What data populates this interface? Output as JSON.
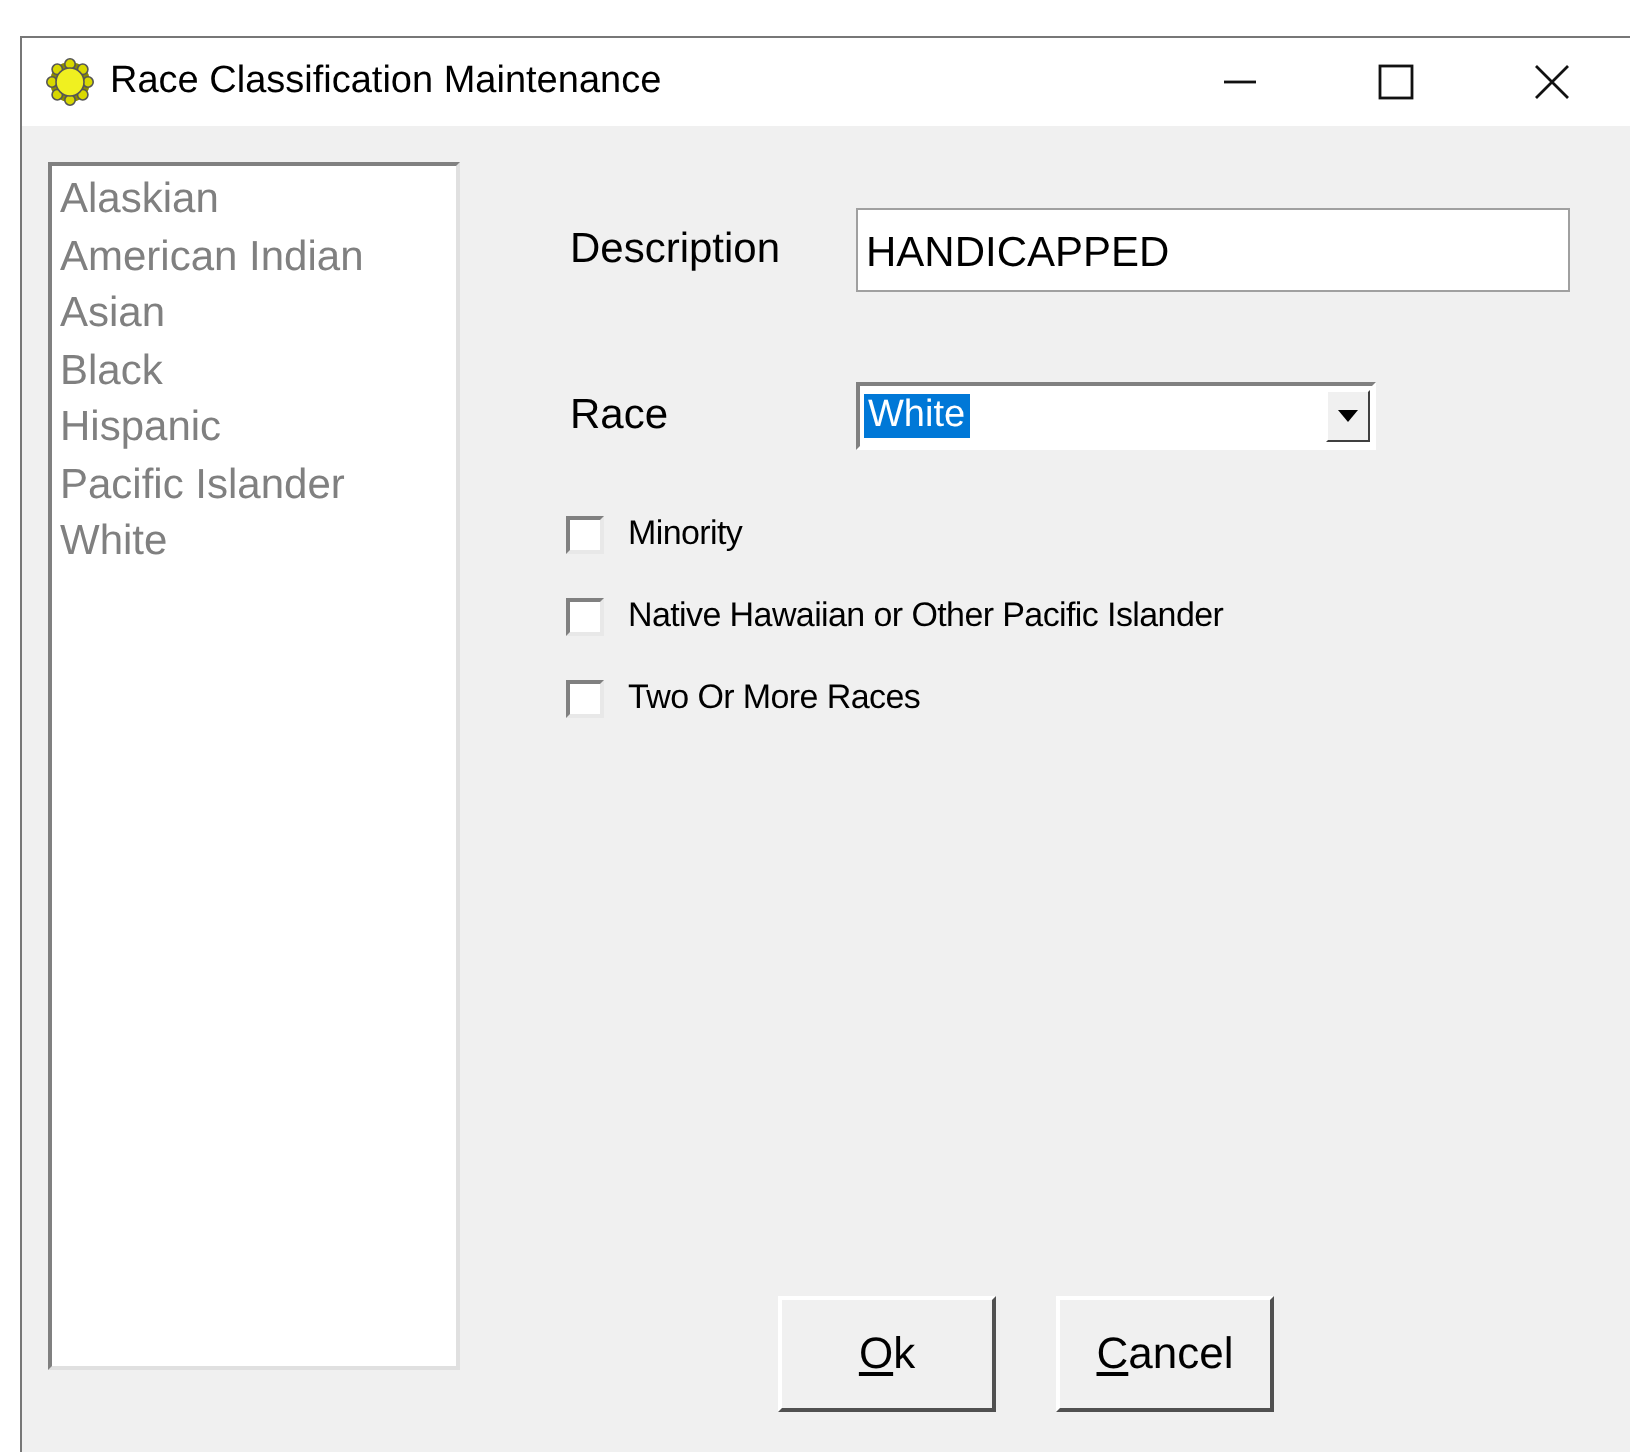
{
  "window": {
    "title": "Race Classification Maintenance"
  },
  "race_list": {
    "disabled": true,
    "items": [
      "Alaskian",
      "American Indian",
      "Asian",
      "Black",
      "Hispanic",
      "Pacific Islander",
      "White"
    ]
  },
  "description": {
    "label": "Description",
    "value": "HANDICAPPED"
  },
  "race": {
    "label": "Race",
    "value": "White",
    "highlighted": true
  },
  "checkboxes": [
    {
      "label": "Minority",
      "checked": false
    },
    {
      "label": "Native Hawaiian or Other Pacific Islander",
      "checked": false
    },
    {
      "label": "Two Or More Races",
      "checked": false
    }
  ],
  "buttons": [
    {
      "mnemonic": "O",
      "rest": "k"
    },
    {
      "mnemonic": "C",
      "rest": "ancel"
    }
  ]
}
